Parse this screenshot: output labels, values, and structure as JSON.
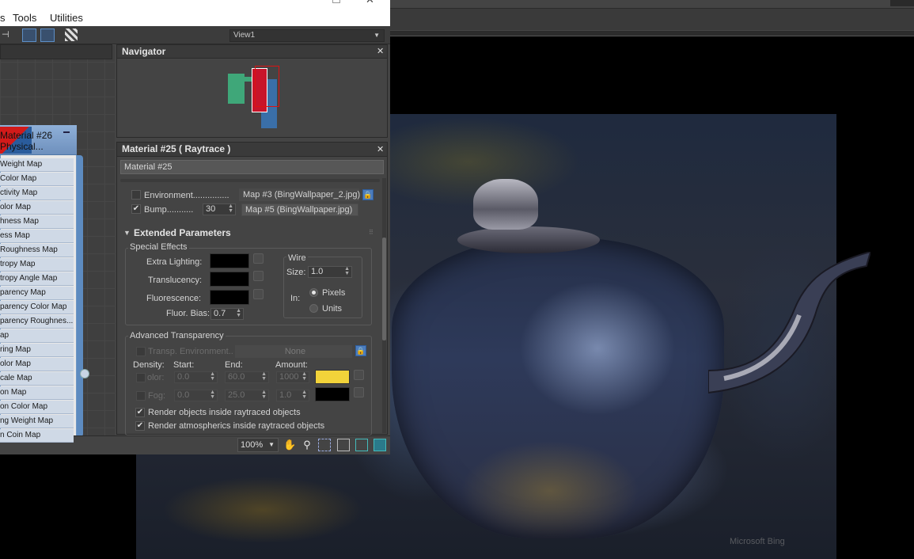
{
  "menu": {
    "items": [
      "s",
      "Tools",
      "Utilities"
    ]
  },
  "toolbar": {
    "view_select": "View1"
  },
  "node": {
    "title_line1": "Material #26",
    "title_line2": "Physical...",
    "slots": [
      "Weight Map",
      "Color Map",
      "ctivity Map",
      "olor Map",
      "hness Map",
      "ess Map",
      "Roughness Map",
      "tropy Map",
      "tropy Angle Map",
      "parency Map",
      "parency Color Map",
      "parency Roughnes...",
      "ap",
      "ring Map",
      "olor Map",
      "cale Map",
      "on Map",
      "on Color Map",
      "ng Weight Map",
      "n Coin Map"
    ]
  },
  "navigator": {
    "title": "Navigator"
  },
  "material": {
    "panel_title": "Material #25  ( Raytrace )",
    "name_value": "Material #25",
    "environment_label": "Environment...............",
    "environment_map": "Map #3 (BingWallpaper_2.jpg)",
    "bump_label": "Bump...........",
    "bump_amount": "30",
    "bump_map": "Map #5 (BingWallpaper.jpg)"
  },
  "extended": {
    "title": "Extended Parameters",
    "special_effects": "Special Effects",
    "extra_lighting": "Extra Lighting:",
    "translucency": "Translucency:",
    "fluorescence": "Fluorescence:",
    "fluor_bias_label": "Fluor. Bias:",
    "fluor_bias_value": "0.7",
    "wire": {
      "title": "Wire",
      "size_label": "Size:",
      "size_value": "1.0",
      "in_label": "In:",
      "pixels": "Pixels",
      "units": "Units"
    }
  },
  "advanced": {
    "title": "Advanced Transparency",
    "transp_env": "Transp. Environment..",
    "none_btn": "None",
    "density": "Density:",
    "start": "Start:",
    "end": "End:",
    "amount": "Amount:",
    "color_label": "olor:",
    "color_start": "0.0",
    "color_end": "60.0",
    "color_amount": "1000",
    "fog_label": "Fog:",
    "fog_start": "0.0",
    "fog_end": "25.0",
    "fog_amount": "1.0",
    "color_swatch": "#f2d33a",
    "render_objects": "Render objects inside raytraced objects",
    "render_atmos": "Render atmospherics inside raytraced objects"
  },
  "bottom": {
    "zoom": "100%"
  },
  "viewport": {
    "watermark": "Microsoft Bing"
  }
}
